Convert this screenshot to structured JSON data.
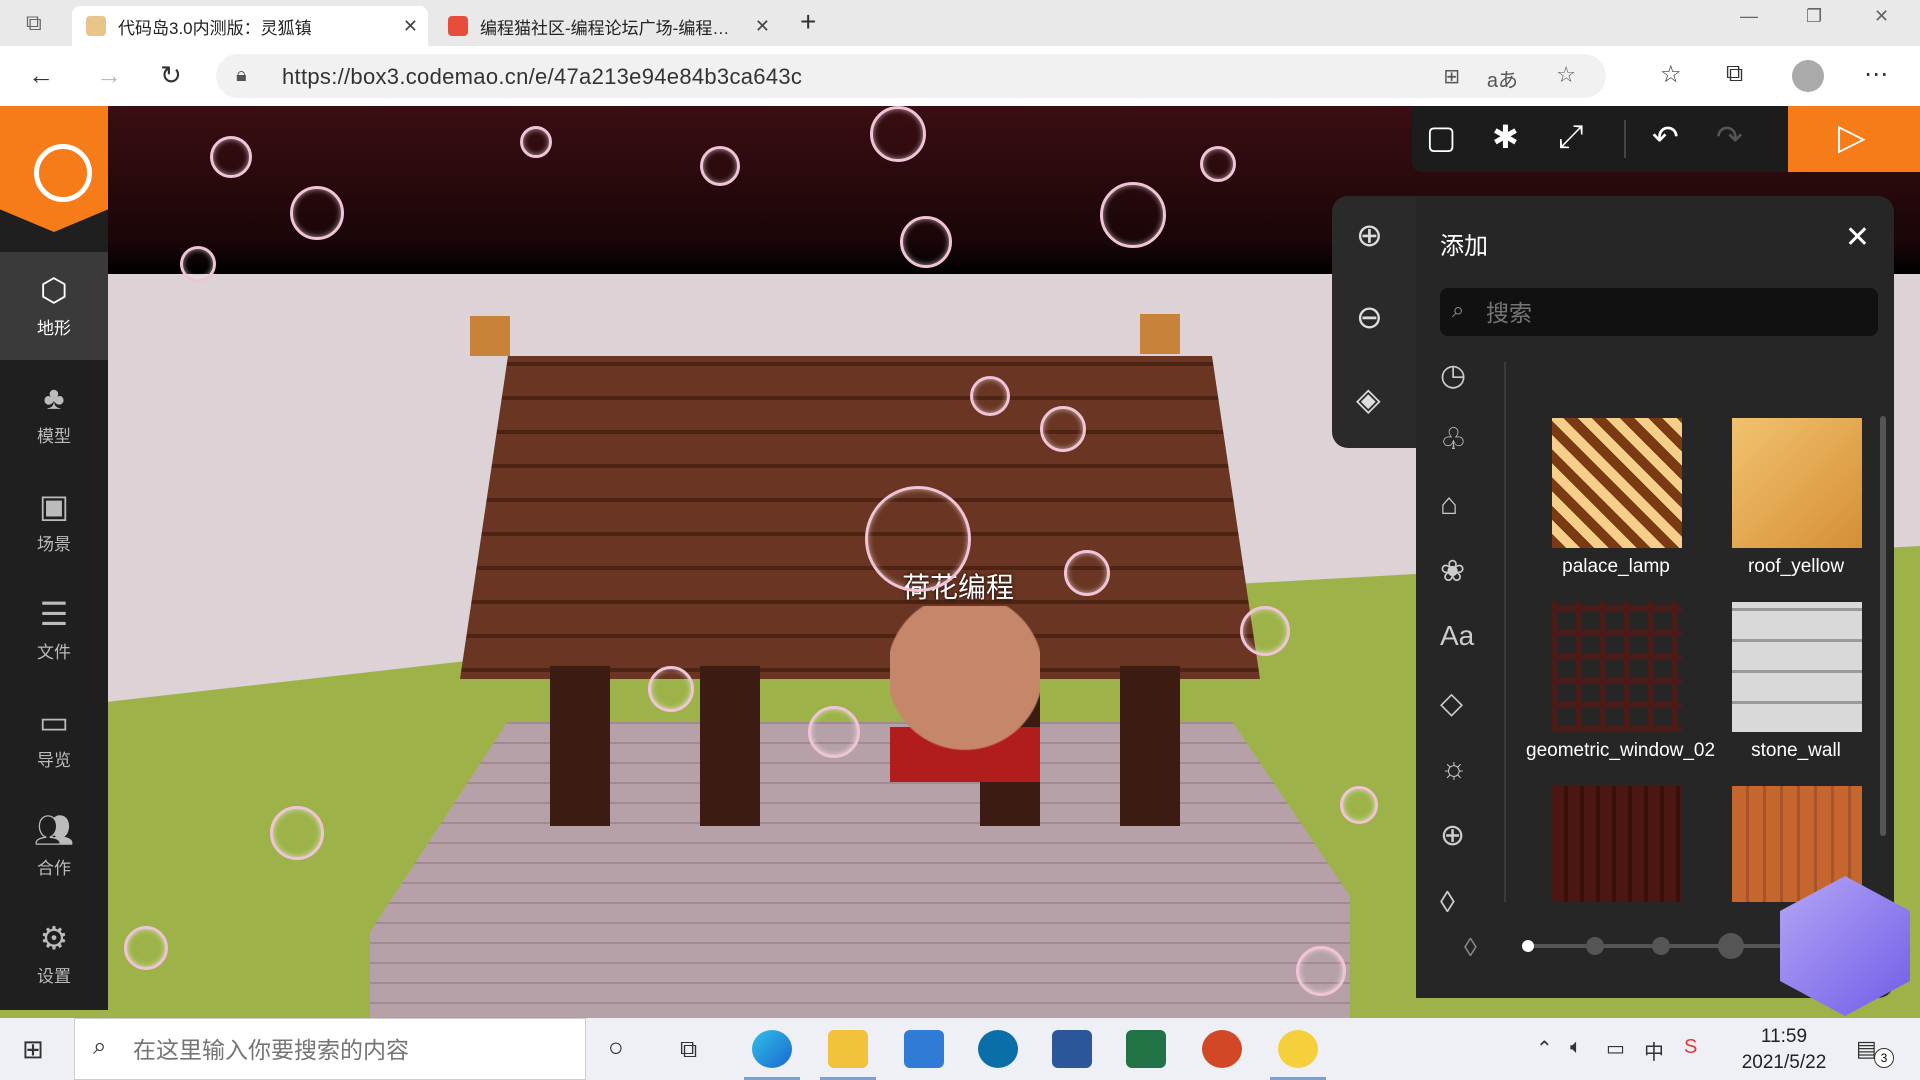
{
  "browser": {
    "tabs": [
      {
        "title": "代码岛3.0内测版：灵狐镇",
        "active": true
      },
      {
        "title": "编程猫社区-编程论坛广场-编程…",
        "active": false
      }
    ],
    "new_tab": "+",
    "url": "https://box3.codemao.cn/e/47a213e94e84b3ca643c"
  },
  "sidebar": {
    "items": [
      {
        "label": "地形",
        "icon": "cube-icon"
      },
      {
        "label": "模型",
        "icon": "tree-icon"
      },
      {
        "label": "场景",
        "icon": "image-icon"
      },
      {
        "label": "文件",
        "icon": "file-icon"
      },
      {
        "label": "导览",
        "icon": "folder-icon"
      },
      {
        "label": "合作",
        "icon": "users-icon"
      },
      {
        "label": "设置",
        "icon": "gear-icon"
      }
    ]
  },
  "scene": {
    "player_name": "荷花编程"
  },
  "panel": {
    "title": "添加",
    "search_placeholder": "搜索",
    "items": [
      {
        "name": "palace_lamp",
        "color": "#c9823a"
      },
      {
        "name": "roof_yellow",
        "color": "#e0a24c"
      },
      {
        "name": "geometric_window_02",
        "color": "#4b1b17"
      },
      {
        "name": "stone_wall",
        "color": "#c9c9c9"
      },
      {
        "name": "",
        "color": "#4b1712"
      },
      {
        "name": "",
        "color": "#c5662e"
      }
    ]
  },
  "taskbar": {
    "search_placeholder": "在这里输入你要搜索的内容",
    "time": "11:59",
    "date": "2021/5/22",
    "notifications": "3"
  },
  "colors": {
    "accent": "#f57c19",
    "panel_bg": "#262626"
  }
}
